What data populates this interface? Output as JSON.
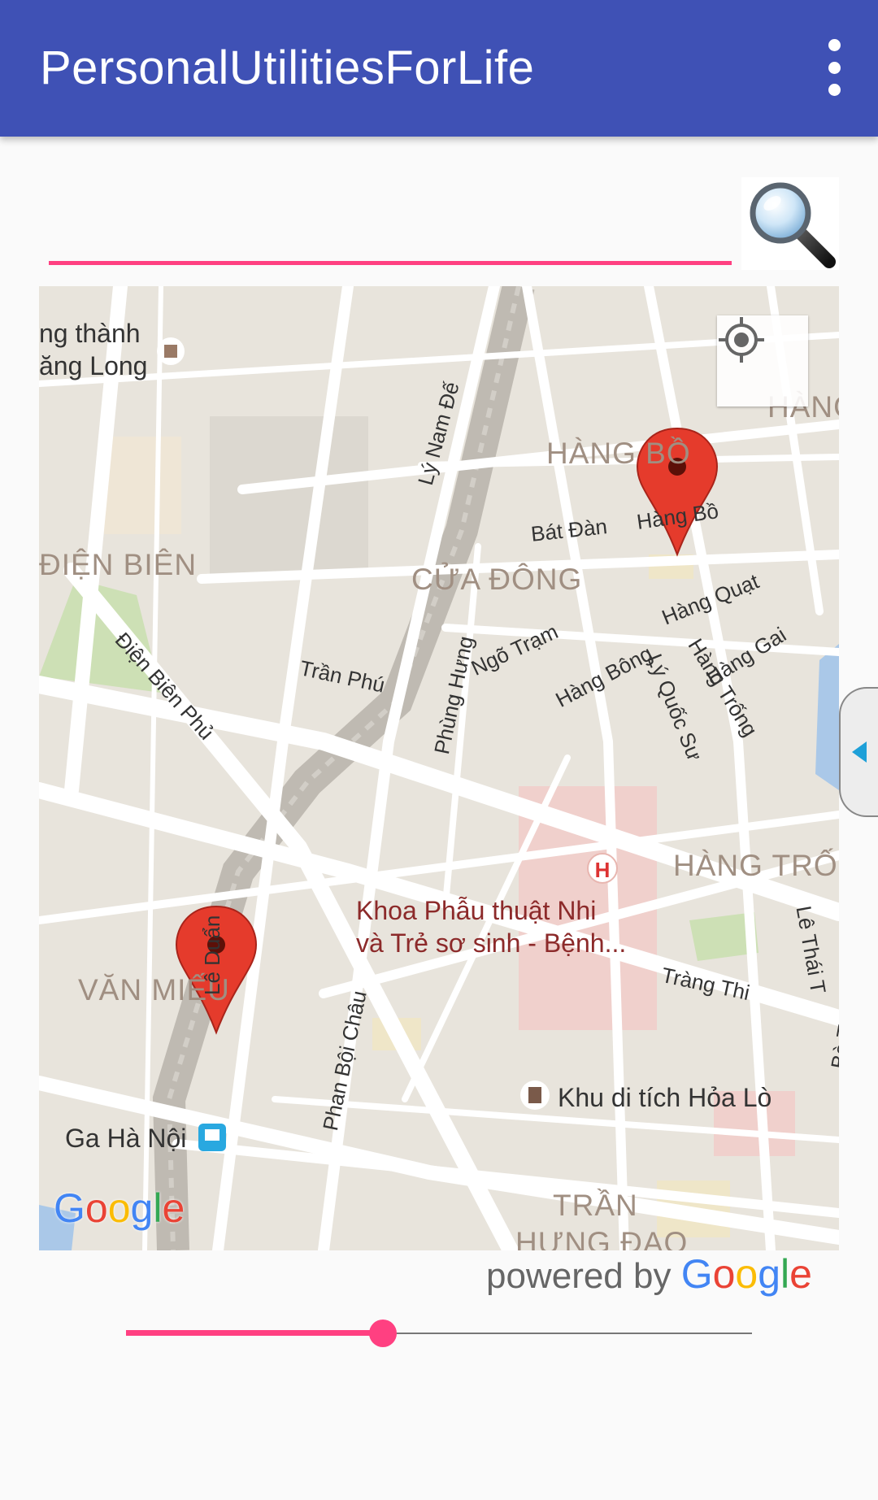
{
  "appbar": {
    "title": "PersonalUtilitiesForLife",
    "overflow_icon": "more-vert-icon",
    "color": "#3f51b5"
  },
  "search": {
    "value": "",
    "button_icon": "magnifier-icon",
    "underline_color": "#ff4081"
  },
  "map": {
    "district_labels": [
      "ĐIỆN BIÊN",
      "HÀNG BỒ",
      "CỬA ĐÔNG",
      "HÀNG TRỐN",
      "VĂN MIẾU",
      "TRẦN",
      "HƯNG ĐẠO",
      "HÀNG"
    ],
    "street_labels": [
      "Lý Nam Đế",
      "Bát Đàn",
      "Hàng Bồ",
      "Hàng Quạt",
      "Hàng Gai",
      "Điện Biên Phủ",
      "Phùng Hưng",
      "Ngõ Trạm",
      "Trần Phú",
      "Hàng Bông",
      "Lý Quốc Sư",
      "Hàng Trống",
      "Lê Duẩn",
      "Phan Bội Châu",
      "Tràng Thi",
      "Lê Thái T",
      "Bà Triệ"
    ],
    "poi_labels": {
      "thang_long_line1": "ng thành",
      "thang_long_line2": "ăng Long",
      "hospital_line1": "Khoa Phẫu thuật Nhi",
      "hospital_line2": "và Trẻ sơ sinh - Bệnh...",
      "hoa_lo": "Khu di tích Hỏa Lò",
      "station": "Ga Hà Nội"
    },
    "attribution": "Google",
    "markers": 2
  },
  "powered_by": {
    "prefix": "powered by ",
    "brand": "Google"
  },
  "slider": {
    "value_fraction": 0.41,
    "accent": "#ff4081"
  }
}
